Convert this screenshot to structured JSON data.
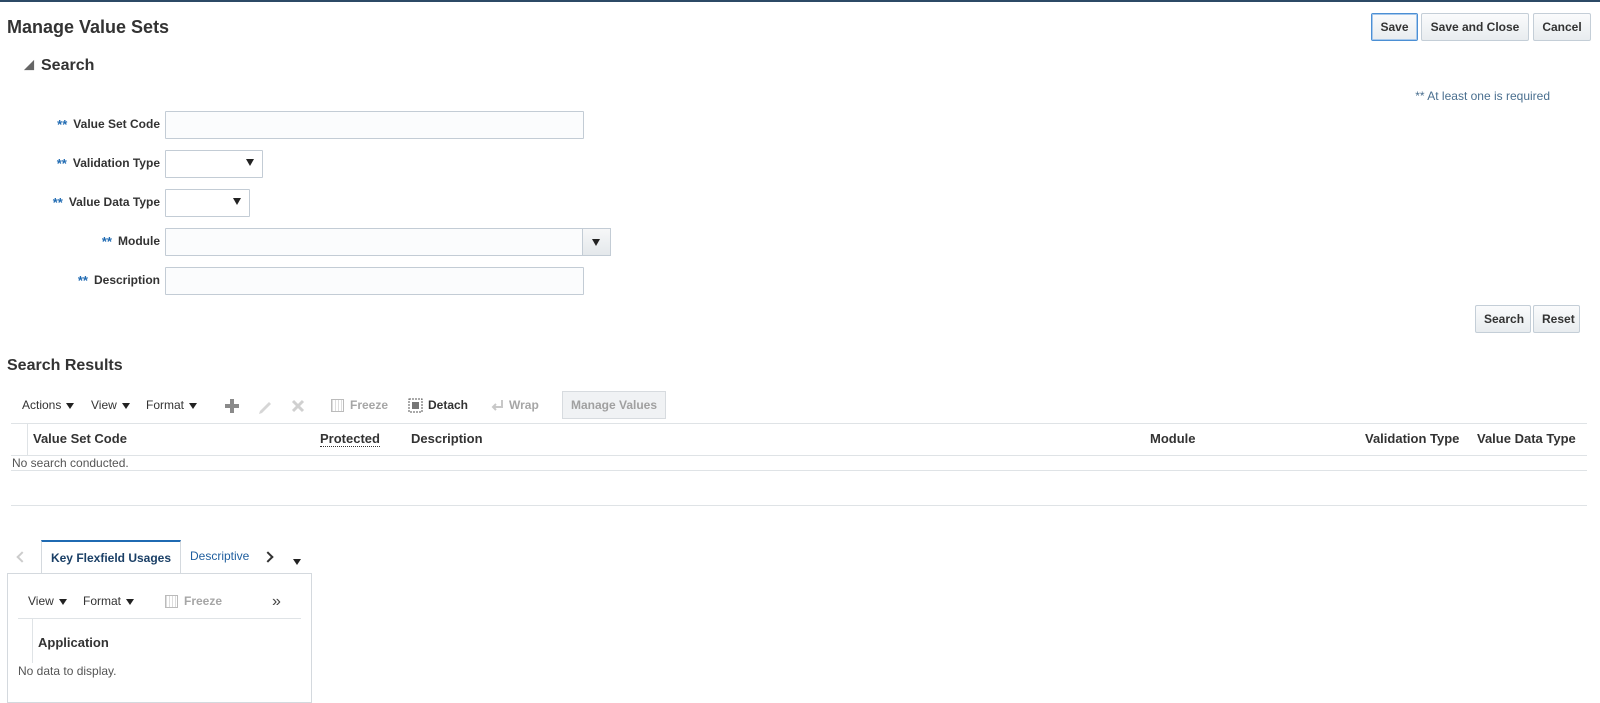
{
  "page": {
    "title": "Manage Value Sets"
  },
  "header_buttons": {
    "save": "Save",
    "save_and_close": "Save and Close",
    "cancel": "Cancel"
  },
  "search": {
    "title": "Search",
    "required_note": "** At least one is required",
    "required_mark": "**",
    "fields": {
      "value_set_code": "Value Set Code",
      "validation_type": "Validation Type",
      "value_data_type": "Value Data Type",
      "module": "Module",
      "description": "Description"
    },
    "buttons": {
      "search": "Search",
      "reset": "Reset"
    }
  },
  "results": {
    "title": "Search Results",
    "toolbar": {
      "actions": "Actions",
      "view": "View",
      "format": "Format",
      "freeze": "Freeze",
      "detach": "Detach",
      "wrap": "Wrap",
      "manage_values": "Manage Values"
    },
    "columns": [
      "Value Set Code",
      "Protected",
      "Description",
      "Module",
      "Validation Type",
      "Value Data Type"
    ],
    "empty_text": "No search conducted."
  },
  "usages": {
    "tabs": [
      "Key Flexfield Usages",
      "Descriptive"
    ],
    "toolbar": {
      "view": "View",
      "format": "Format",
      "freeze": "Freeze"
    },
    "columns": [
      "Application"
    ],
    "empty_text": "No data to display."
  },
  "icons": {
    "add": "plus-icon",
    "edit": "pencil-icon",
    "delete": "x-icon",
    "freeze": "freeze-icon",
    "detach": "detach-icon",
    "wrap": "wrap-icon"
  },
  "colors": {
    "accent": "#1f6ab2",
    "top_bar": "#2c4a66"
  }
}
